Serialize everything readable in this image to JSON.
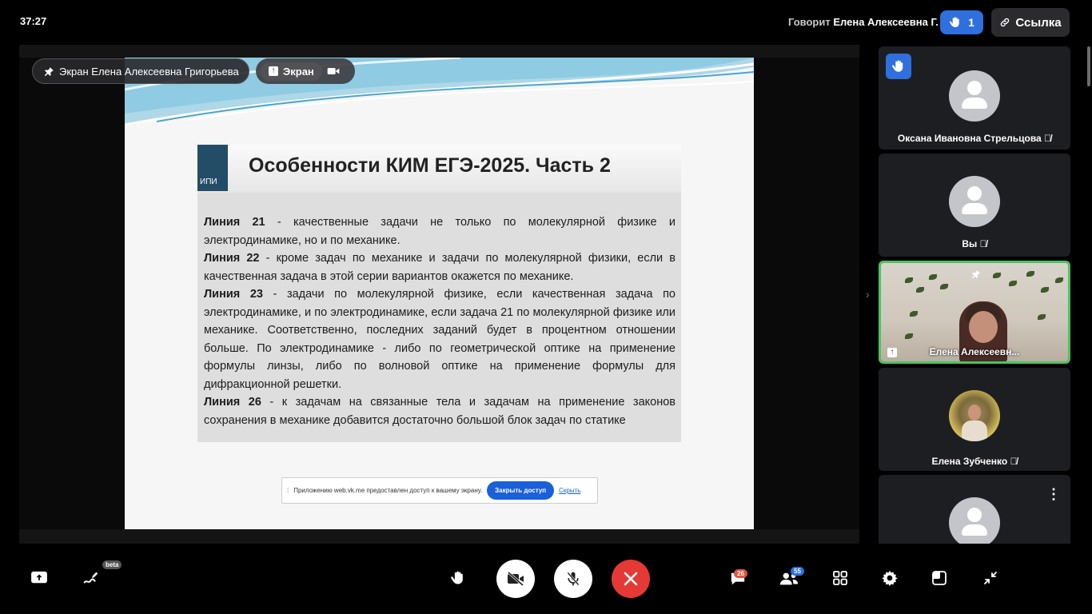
{
  "header": {
    "timer": "37:27",
    "speaking_prefix": "Говорит",
    "speaking_name": "Елена Алексеевна Г.",
    "raised_hands_count": "1",
    "link_label": "Ссылка"
  },
  "stage": {
    "pinned_label": "Экран Елена Алексеевна Григорьева",
    "source_screen_label": "Экран",
    "slide": {
      "logo_text": "ИПИ",
      "title": "Особенности КИМ ЕГЭ-2025. Часть 2",
      "paragraphs": [
        {
          "bold": "Линия 21",
          "text": " - качественные задачи не только по молекулярной физике и электродинамике, но и по механике."
        },
        {
          "bold": "Линия 22",
          "text": " - кроме задач по механике и задачи по молекулярной физики, если в качественная задача в этой серии вариантов окажется по механике."
        },
        {
          "bold": "Линия 23",
          "text": " - задачи по молекулярной физике, если качественная задача по электродинамике, и по электродинамике, если задача 21 по молекулярной физике или механике. Соответственно, последних заданий будет в процентном отношении больше. По электродинамике - либо по геометрической оптике на применение формулы линзы, либо по волновой оптике на применение формулы для дифракционной решетки."
        },
        {
          "bold": "Линия 26",
          "text": " - к задачам на связанные тела и задачам на применение законов сохранения в механике добавится достаточно большой блок задач по статике"
        }
      ],
      "share_notice": "Приложению web.vk.me предоставлен доступ к вашему экрану.",
      "share_stop": "Закрыть доступ",
      "share_hide": "Скрыть"
    }
  },
  "participants": [
    {
      "name": "Оксана Ивановна Стрельцова",
      "muted": true,
      "hand_raised": true
    },
    {
      "name": "Вы",
      "muted": true
    },
    {
      "name": "Елена Алексеевн...",
      "speaking": true,
      "sharing": true,
      "pinned": true
    },
    {
      "name": "Елена Зубченко",
      "muted": true
    },
    {
      "name": ""
    }
  ],
  "toolbar": {
    "beta_label": "beta",
    "chat_badge": "26",
    "participants_badge": "55"
  },
  "colors": {
    "accent_blue": "#2f6fde",
    "end_call_red": "#e53935",
    "speaking_green": "#4cc35c"
  }
}
